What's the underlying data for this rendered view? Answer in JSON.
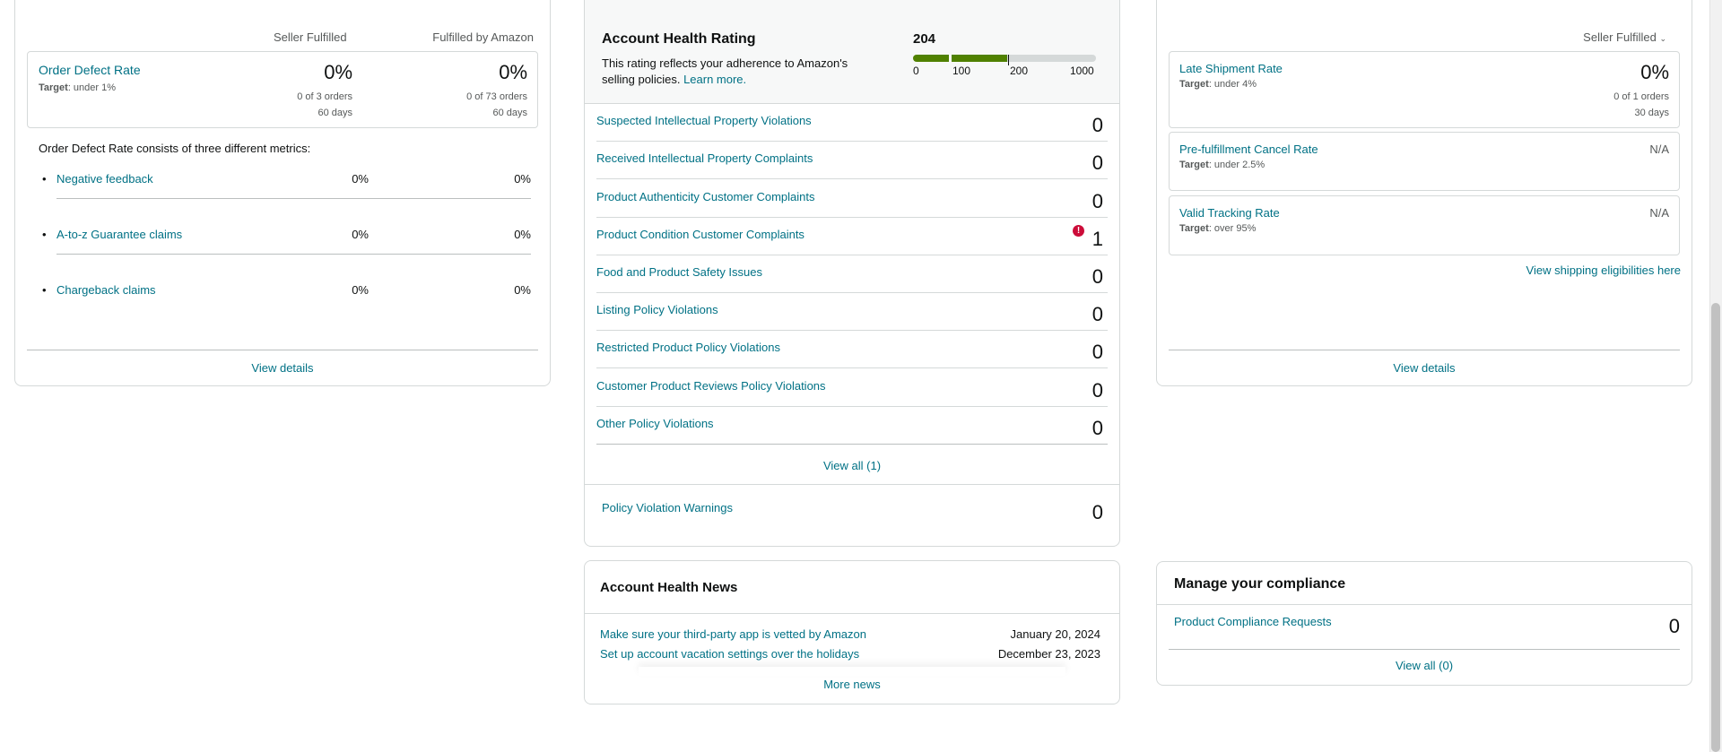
{
  "odr": {
    "col_seller": "Seller Fulfilled",
    "col_amazon": "Fulfilled by Amazon",
    "title": "Order Defect Rate",
    "target_label": "Target",
    "target_value": ": under 1%",
    "seller_pct": "0%",
    "seller_orders": "0 of 3 orders",
    "seller_days": "60 days",
    "amazon_pct": "0%",
    "amazon_orders": "0 of 73 orders",
    "amazon_days": "60 days",
    "consists_text": "Order Defect Rate consists of three different metrics:",
    "metrics": [
      {
        "label": "Negative feedback",
        "seller": "0%",
        "amazon": "0%"
      },
      {
        "label": "A-to-z Guarantee claims",
        "seller": "0%",
        "amazon": "0%"
      },
      {
        "label": "Chargeback claims",
        "seller": "0%",
        "amazon": "0%"
      }
    ],
    "view_details": "View details"
  },
  "ahr": {
    "title": "Account Health Rating",
    "score": "204",
    "score_value": 204,
    "description": "This rating reflects your adherence to Amazon's selling policies.",
    "learn_more": "Learn more.",
    "scale_labels": [
      "0",
      "100",
      "200",
      "1000"
    ],
    "bar_colors": {
      "good": "#508100",
      "empty": "#d5d9d9"
    },
    "violations": [
      {
        "label": "Suspected Intellectual Property Violations",
        "count": "0",
        "alert": false
      },
      {
        "label": "Received Intellectual Property Complaints",
        "count": "0",
        "alert": false
      },
      {
        "label": "Product Authenticity Customer Complaints",
        "count": "0",
        "alert": false
      },
      {
        "label": "Product Condition Customer Complaints",
        "count": "1",
        "alert": true
      },
      {
        "label": "Food and Product Safety Issues",
        "count": "0",
        "alert": false
      },
      {
        "label": "Listing Policy Violations",
        "count": "0",
        "alert": false
      },
      {
        "label": "Restricted Product Policy Violations",
        "count": "0",
        "alert": false
      },
      {
        "label": "Customer Product Reviews Policy Violations",
        "count": "0",
        "alert": false
      },
      {
        "label": "Other Policy Violations",
        "count": "0",
        "alert": false
      }
    ],
    "view_all": "View all (1)",
    "warnings_label": "Policy Violation Warnings",
    "warnings_count": "0",
    "alert_color": "#cc0c39"
  },
  "news": {
    "title": "Account Health News",
    "items": [
      {
        "label": "Make sure your third-party app is vetted by Amazon",
        "date": "January 20, 2024"
      },
      {
        "label": "Set up account vacation settings over the holidays",
        "date": "December 23, 2023"
      }
    ],
    "more": "More news"
  },
  "shipping": {
    "dropdown": "Seller Fulfilled",
    "late": {
      "title": "Late Shipment Rate",
      "target_label": "Target",
      "target_value": ": under 4%",
      "pct": "0%",
      "orders": "0 of 1 orders",
      "days": "30 days"
    },
    "cancel": {
      "title": "Pre-fulfillment Cancel Rate",
      "target_label": "Target",
      "target_value": ": under 2.5%",
      "value": "N/A"
    },
    "tracking": {
      "title": "Valid Tracking Rate",
      "target_label": "Target",
      "target_value": ": over 95%",
      "value": "N/A"
    },
    "eligibilities": "View shipping eligibilities here",
    "view_details": "View details"
  },
  "compliance": {
    "title": "Manage your compliance",
    "requests_label": "Product Compliance Requests",
    "requests_count": "0",
    "view_all": "View all (0)"
  }
}
